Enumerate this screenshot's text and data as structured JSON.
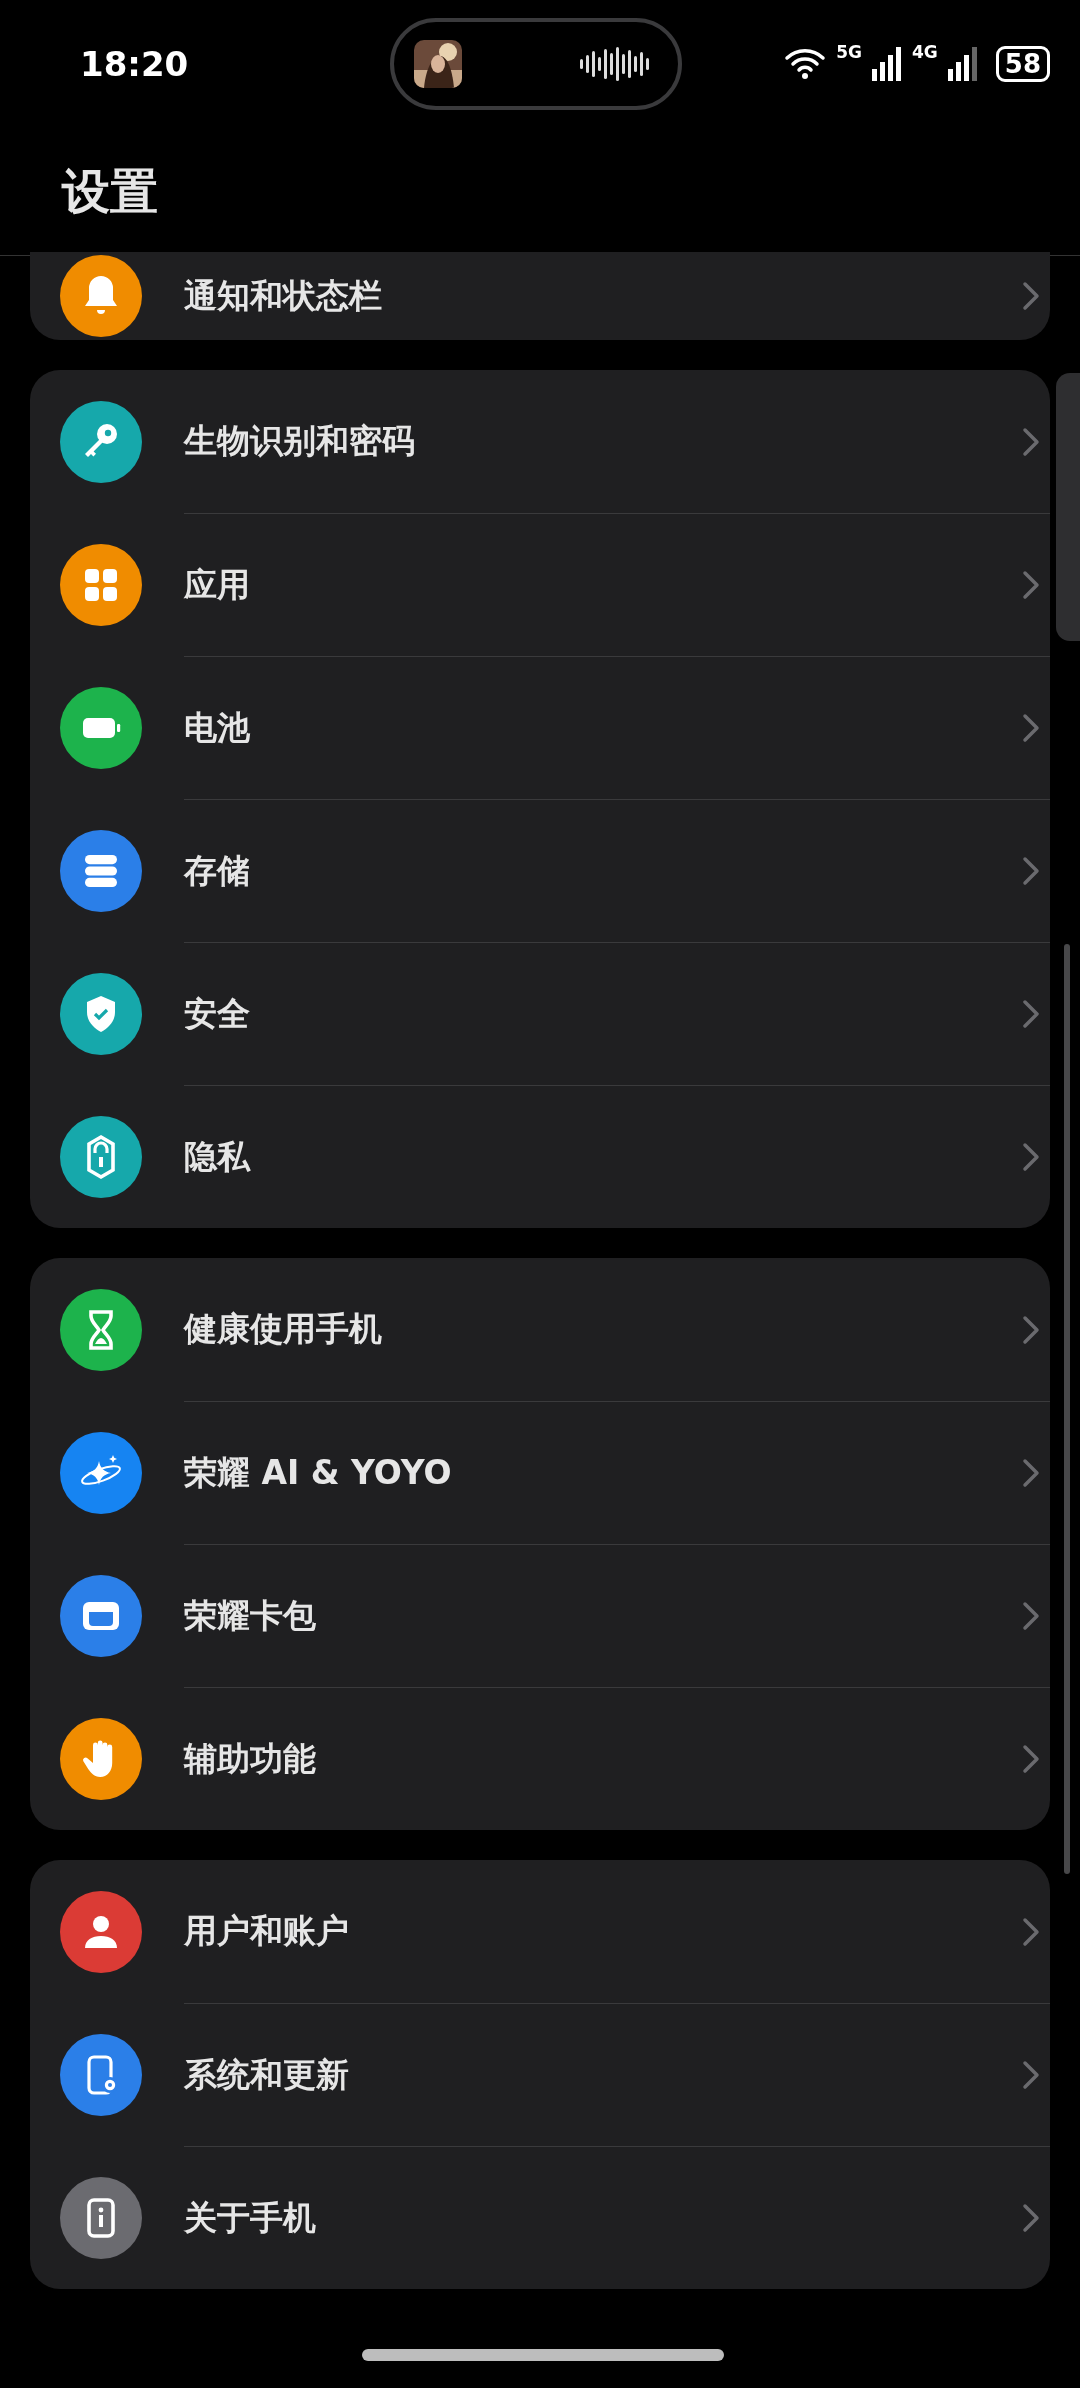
{
  "status_bar": {
    "time": "18:20",
    "network_1": "5G",
    "network_2": "4G",
    "battery": "58"
  },
  "title": "设置",
  "groups": [
    {
      "scrolled_under": true,
      "items": [
        {
          "label": "通知和状态栏",
          "color": "#f08c00"
        }
      ]
    },
    {
      "scrolled_under": false,
      "items": [
        {
          "label": "生物识别和密码",
          "color": "#16a8ab"
        },
        {
          "label": "应用",
          "color": "#f08c00"
        },
        {
          "label": "电池",
          "color": "#1db34c"
        },
        {
          "label": "存储",
          "color": "#2b7fe8"
        },
        {
          "label": "安全",
          "color": "#16a8ab"
        },
        {
          "label": "隐私",
          "color": "#16a8ab"
        }
      ]
    },
    {
      "scrolled_under": false,
      "items": [
        {
          "label": "健康使用手机",
          "color": "#1db34c"
        },
        {
          "label": "荣耀 AI & YOYO",
          "color": "#1684f2"
        },
        {
          "label": "荣耀卡包",
          "color": "#2b7fe8"
        },
        {
          "label": "辅助功能",
          "color": "#f08c00"
        }
      ]
    },
    {
      "scrolled_under": false,
      "items": [
        {
          "label": "用户和账户",
          "color": "#db3b35"
        },
        {
          "label": "系统和更新",
          "color": "#2b7fe8"
        },
        {
          "label": "关于手机",
          "color": "#6b6b70"
        }
      ]
    }
  ]
}
